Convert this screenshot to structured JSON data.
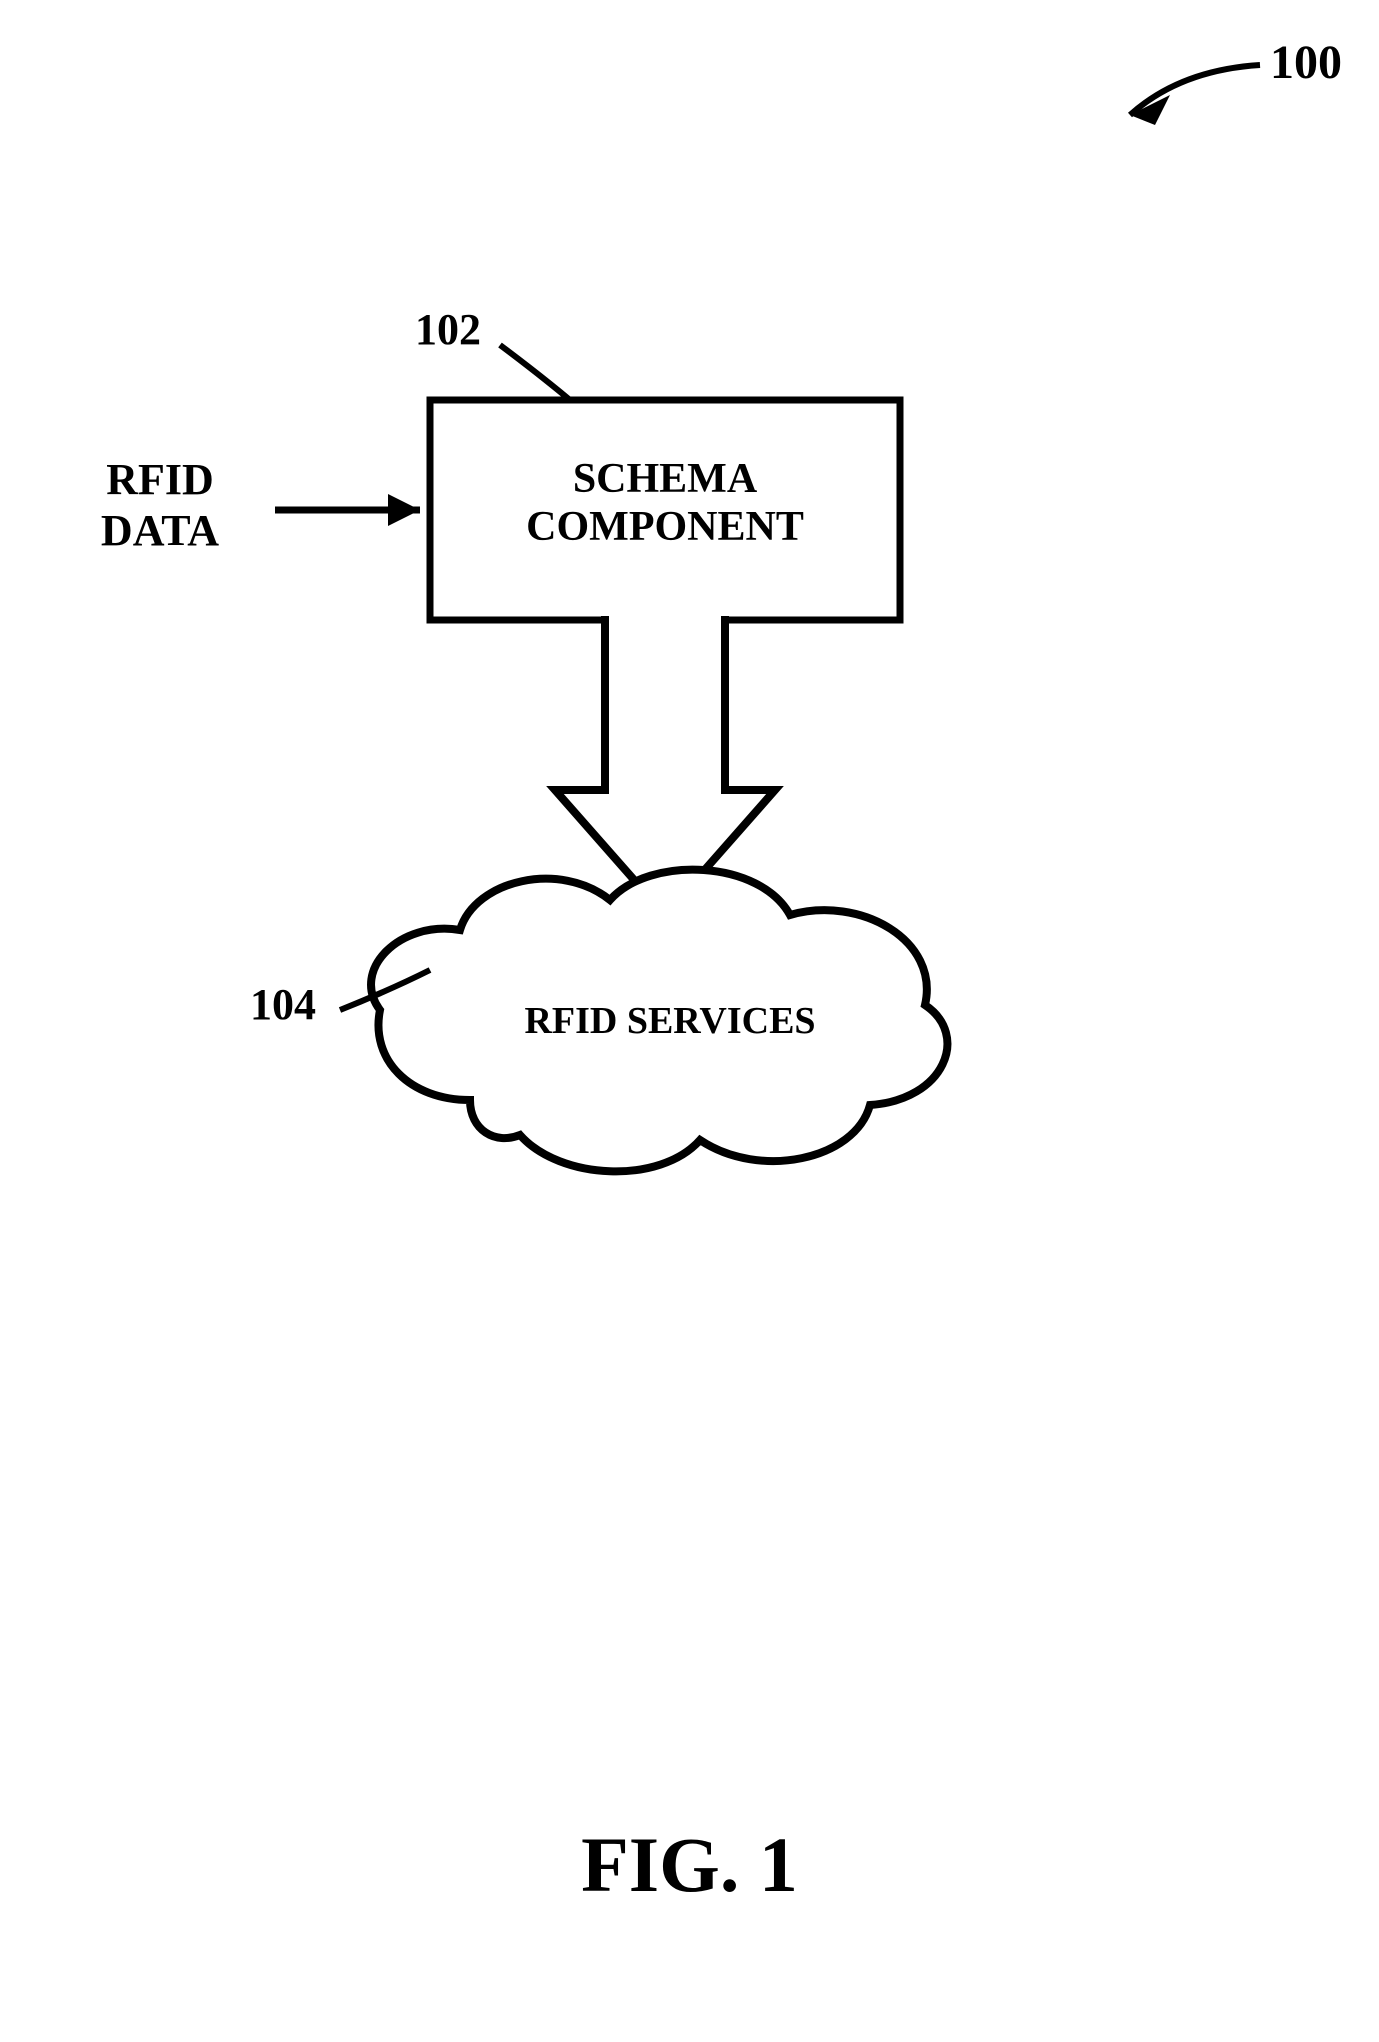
{
  "figure_ref_100": "100",
  "ref_102": "102",
  "ref_104": "104",
  "input_label_line1": "RFID",
  "input_label_line2": "DATA",
  "box_line1": "SCHEMA",
  "box_line2": "COMPONENT",
  "cloud_label": "RFID SERVICES",
  "figure_caption": "FIG. 1"
}
